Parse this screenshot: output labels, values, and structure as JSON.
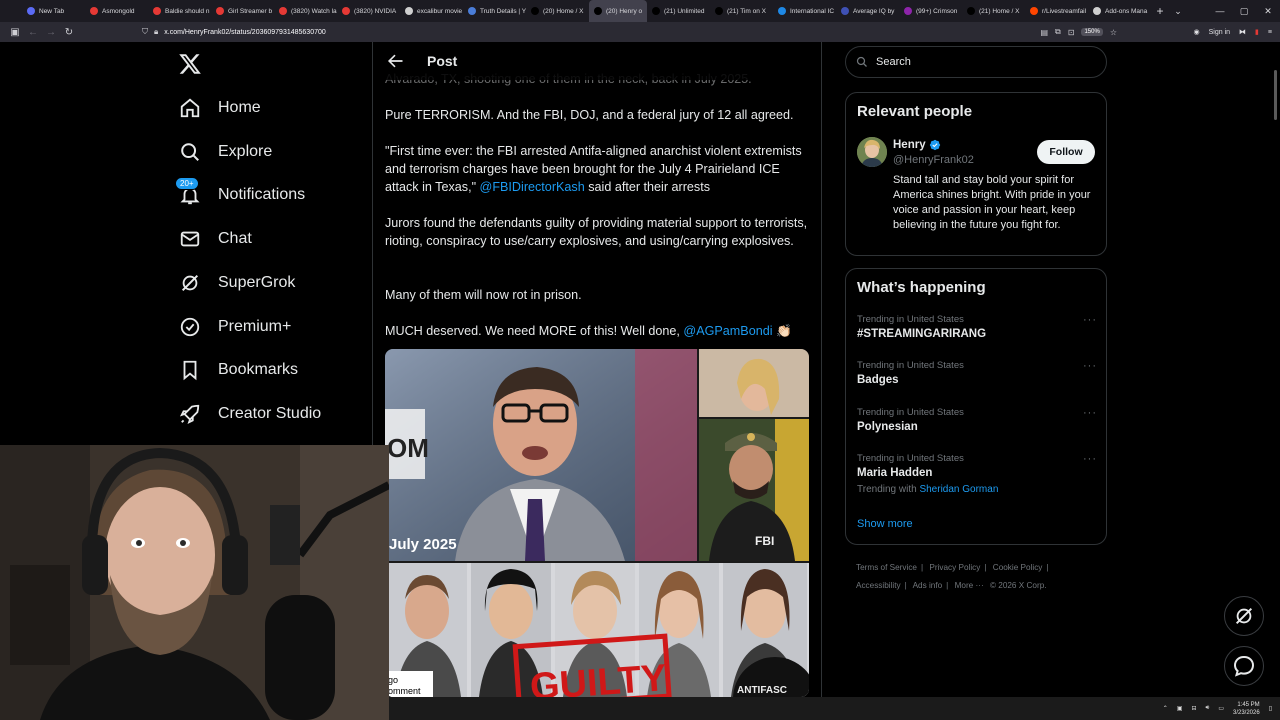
{
  "browser": {
    "tabs": [
      {
        "label": "New Tab",
        "color": "#5b6bf5"
      },
      {
        "label": "Asmongold",
        "color": "#e53935"
      },
      {
        "label": "Baldie should n",
        "color": "#e53935"
      },
      {
        "label": "Girl Streamer b",
        "color": "#e53935"
      },
      {
        "label": "(3820) Watch la",
        "color": "#e53935"
      },
      {
        "label": "(3820) NVIDIA",
        "color": "#e53935"
      },
      {
        "label": "excalibur movie",
        "color": "#cfcfcf"
      },
      {
        "label": "Truth Details | Y",
        "color": "#4a7dd8"
      },
      {
        "label": "(20) Home / X",
        "color": "#000000"
      },
      {
        "label": "(20) Henry o",
        "color": "#000000",
        "active": true
      },
      {
        "label": "(21) Unlimited",
        "color": "#000000"
      },
      {
        "label": "(21) Tim on X",
        "color": "#000000"
      },
      {
        "label": "International IC",
        "color": "#1e88e5"
      },
      {
        "label": "Average IQ by",
        "color": "#3f51b5"
      },
      {
        "label": "(99+) Crimson",
        "color": "#8e24aa"
      },
      {
        "label": "(21) Home / X",
        "color": "#000000"
      },
      {
        "label": "r/Livestreamfail",
        "color": "#ff4500"
      },
      {
        "label": "Add-ons Mana",
        "color": "#cfcfcf"
      }
    ],
    "url": "x.com/HenryFrank02/status/2036097931485630700",
    "zoom": "150%",
    "sign_in": "Sign in"
  },
  "sidebar": {
    "items": [
      {
        "label": "Home",
        "icon": "home-icon"
      },
      {
        "label": "Explore",
        "icon": "search-icon"
      },
      {
        "label": "Notifications",
        "icon": "bell-icon",
        "badge": "20+"
      },
      {
        "label": "Chat",
        "icon": "mail-icon"
      },
      {
        "label": "SuperGrok",
        "icon": "grok-icon"
      },
      {
        "label": "Premium+",
        "icon": "verified-icon"
      },
      {
        "label": "Bookmarks",
        "icon": "bookmark-icon"
      },
      {
        "label": "Creator Studio",
        "icon": "rocket-icon"
      }
    ]
  },
  "post": {
    "header": "Post",
    "cut_line": "Alvarado, TX, shooting one of them in the neck, back in July 2025.",
    "p1": "Pure TERRORISM. And the FBI, DOJ, and a federal jury of 12 all agreed.",
    "p2_text": "\"First time ever: the FBI arrested Antifa-aligned anarchist violent extremists and terrorism charges have been brought for the July 4 Prairieland ICE attack in Texas,\" ",
    "p2_mention": "@FBIDirectorKash",
    "p2_tail": " said after their arrests",
    "p3": "Jurors found the defendants guilty of providing material support to terrorists, rioting, conspiracy to use/carry explosives, and using/carrying explosives.",
    "p4": "Many of them will now rot in prison.",
    "p5_text": "MUCH deserved. We need MORE of this! Well done, ",
    "p5_mention": "@AGPamBondi",
    "p5_emoji": "👏🏻",
    "media": {
      "caption": "July 2025",
      "stamp": "GUILTY",
      "badge": "FBI",
      "corner": "go\nomment",
      "screen_letters": "OM",
      "antifa": "ANTIFASC"
    }
  },
  "right": {
    "search_placeholder": "Search",
    "relevant_title": "Relevant people",
    "person": {
      "name": "Henry",
      "handle": "@HenryFrank02",
      "follow": "Follow",
      "bio": "Stand tall and stay bold your spirit for America shines bright. With pride in your voice and passion in your heart, keep believing in the future you fight for."
    },
    "happening_title": "What’s happening",
    "trends": [
      {
        "meta": "Trending in United States",
        "title": "#STREAMINGARIRANG"
      },
      {
        "meta": "Trending in United States",
        "title": "Badges"
      },
      {
        "meta": "Trending in United States",
        "title": "Polynesian"
      },
      {
        "meta": "Trending in United States",
        "title": "Maria Hadden",
        "with_prefix": "Trending with",
        "with": "Sheridan Gorman"
      }
    ],
    "show_more": "Show more",
    "footer": [
      "Terms of Service",
      "|",
      "Privacy Policy",
      "|",
      "Cookie Policy",
      "|",
      "Accessibility",
      "|",
      "Ads info",
      "|",
      "More ···",
      "© 2026 X Corp."
    ]
  },
  "taskbar": {
    "time": "1:45 PM",
    "date": "3/23/2026"
  },
  "colors": {
    "accent": "#1d9bf0",
    "background": "#000000",
    "text": "#e7e9ea",
    "muted": "#71767b"
  }
}
